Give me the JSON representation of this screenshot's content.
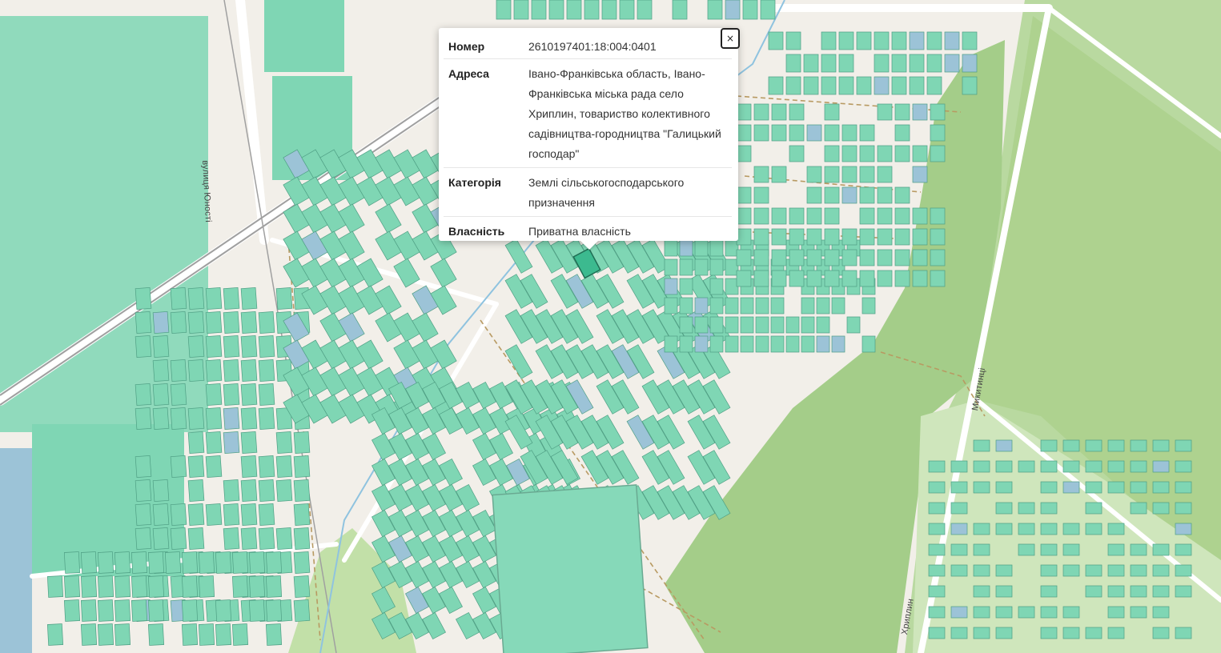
{
  "popup": {
    "close_label": "×",
    "rows": [
      {
        "key": "Номер",
        "value": "2610197401:18:004:0401"
      },
      {
        "key": "Адреса",
        "value": "Івано-Франківська область, Івано-Франківська міська рада село Хриплин, товариство колективного садівництва-городництва \"Галицький господар\""
      },
      {
        "key": "Категорія",
        "value": "Землі сільськогосподарського призначення"
      },
      {
        "key": "Власність",
        "value": "Приватна власність"
      }
    ]
  },
  "streets": {
    "yunosti": "вулиця Юності",
    "mykytyntsi": "Микитинці",
    "khryplyn": "Хриплин"
  },
  "colors": {
    "background": "#f2efe9",
    "parcel_fill": "#7fd6b4",
    "parcel_blue": "#9cc3d7",
    "forest": "#a9cf8e",
    "road": "#ffffff",
    "path": "#b59a66",
    "railway": "#9a9a9a",
    "popup_bg": "#ffffff"
  }
}
